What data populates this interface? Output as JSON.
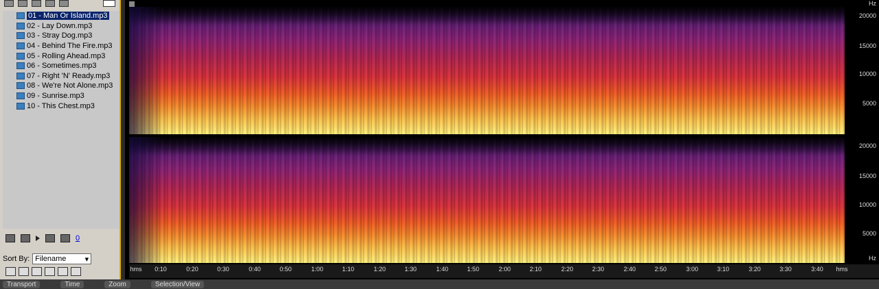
{
  "files": [
    {
      "name": "01 - Man Or Island.mp3",
      "selected": true
    },
    {
      "name": "02 - Lay Down.mp3"
    },
    {
      "name": "03 - Stray Dog.mp3"
    },
    {
      "name": "04 - Behind The Fire.mp3"
    },
    {
      "name": "05 - Rolling Ahead.mp3"
    },
    {
      "name": "06 - Sometimes.mp3"
    },
    {
      "name": "07 - Right 'N' Ready.mp3"
    },
    {
      "name": "08 - We're Not Alone.mp3"
    },
    {
      "name": "09 - Sunrise.mp3"
    },
    {
      "name": "10 - This Chest.mp3"
    }
  ],
  "transport": {
    "volume_value": "0"
  },
  "sort": {
    "label": "Sort By:",
    "value": "Filename"
  },
  "hz_scale": {
    "labels": [
      "20000",
      "15000",
      "10000",
      "5000",
      "Hz"
    ]
  },
  "time_ruler": {
    "ticks": [
      "hms",
      "0:10",
      "0:20",
      "0:30",
      "0:40",
      "0:50",
      "1:00",
      "1:10",
      "1:20",
      "1:30",
      "1:40",
      "1:50",
      "2:00",
      "2:10",
      "2:20",
      "2:30",
      "2:40",
      "2:50",
      "3:00",
      "3:10",
      "3:20",
      "3:30",
      "3:40",
      "hms"
    ]
  },
  "status_bar": {
    "tabs": [
      "Transport",
      "Time",
      "Zoom",
      "Selection/View"
    ]
  },
  "colors": {
    "panel_bg": "#d4d0c8",
    "accent_border": "#e0b000",
    "selection": "#0a246a"
  }
}
